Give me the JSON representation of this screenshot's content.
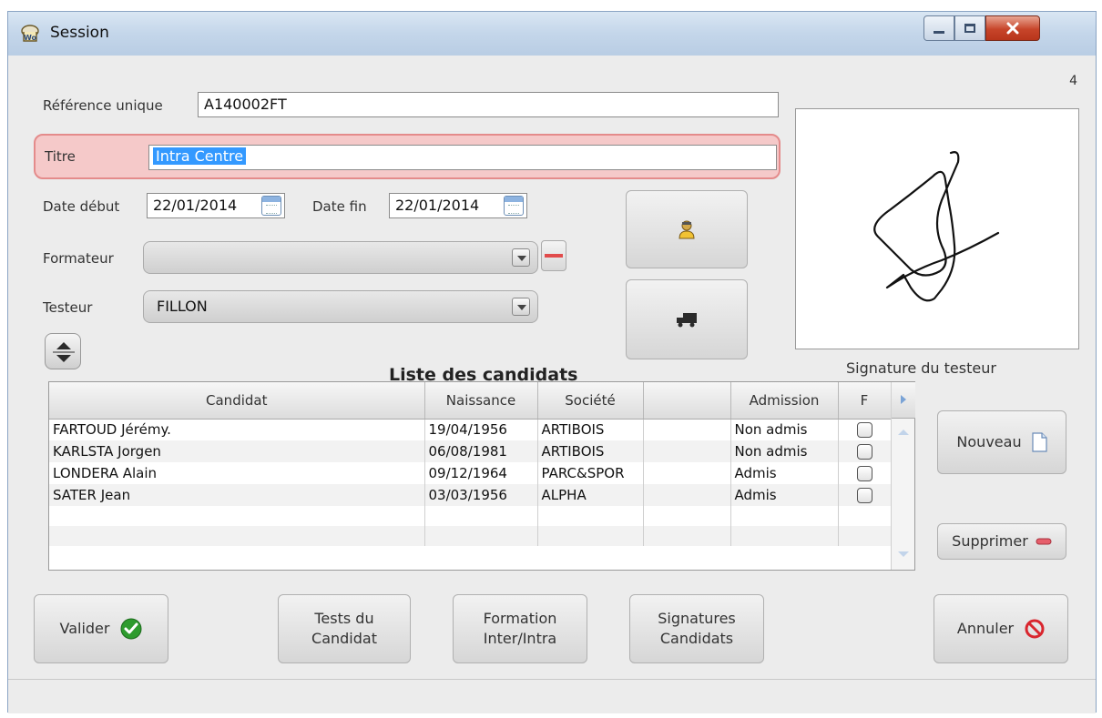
{
  "window": {
    "title": "Session",
    "counter": "4"
  },
  "form": {
    "ref_label": "Référence unique",
    "ref_value": "A140002FT",
    "titre_label": "Titre",
    "titre_value": "Intra Centre",
    "date_debut_label": "Date début",
    "date_debut_value": "22/01/2014",
    "date_fin_label": "Date fin",
    "date_fin_value": "22/01/2014",
    "formateur_label": "Formateur",
    "formateur_value": "",
    "testeur_label": "Testeur",
    "testeur_value": "FILLON"
  },
  "signature": {
    "label": "Signature du testeur"
  },
  "list": {
    "title": "Liste des candidats",
    "headers": [
      "Candidat",
      "Naissance",
      "Société",
      "",
      "Admission",
      "F"
    ],
    "rows": [
      {
        "candidat": "FARTOUD Jérémy.",
        "naissance": "19/04/1956",
        "societe": "ARTIBOIS",
        "extra": "",
        "admission": "Non admis"
      },
      {
        "candidat": "KARLSTA Jorgen",
        "naissance": "06/08/1981",
        "societe": "ARTIBOIS",
        "extra": "",
        "admission": "Non admis"
      },
      {
        "candidat": "LONDERA Alain",
        "naissance": "09/12/1964",
        "societe": "PARC&SPOR",
        "extra": "",
        "admission": "Admis"
      },
      {
        "candidat": "SATER Jean",
        "naissance": "03/03/1956",
        "societe": "ALPHA",
        "extra": "",
        "admission": "Admis"
      }
    ]
  },
  "buttons": {
    "nouveau": "Nouveau",
    "supprimer": "Supprimer",
    "valider": "Valider",
    "tests_line1": "Tests du",
    "tests_line2": "Candidat",
    "formation_line1": "Formation",
    "formation_line2": "Inter/Intra",
    "signatures_line1": "Signatures",
    "signatures_line2": "Candidats",
    "annuler": "Annuler"
  },
  "colors": {
    "titre_highlight": "#f5c9c9",
    "selection": "#3399ff",
    "valider_icon": "#2e9b2e",
    "annuler_icon": "#d9262e"
  },
  "icons": [
    "session-app-icon",
    "person-icon",
    "truck-icon",
    "sort-updown-icon",
    "document-icon",
    "minus-icon",
    "check-icon",
    "no-entry-icon",
    "calendar-icon"
  ]
}
